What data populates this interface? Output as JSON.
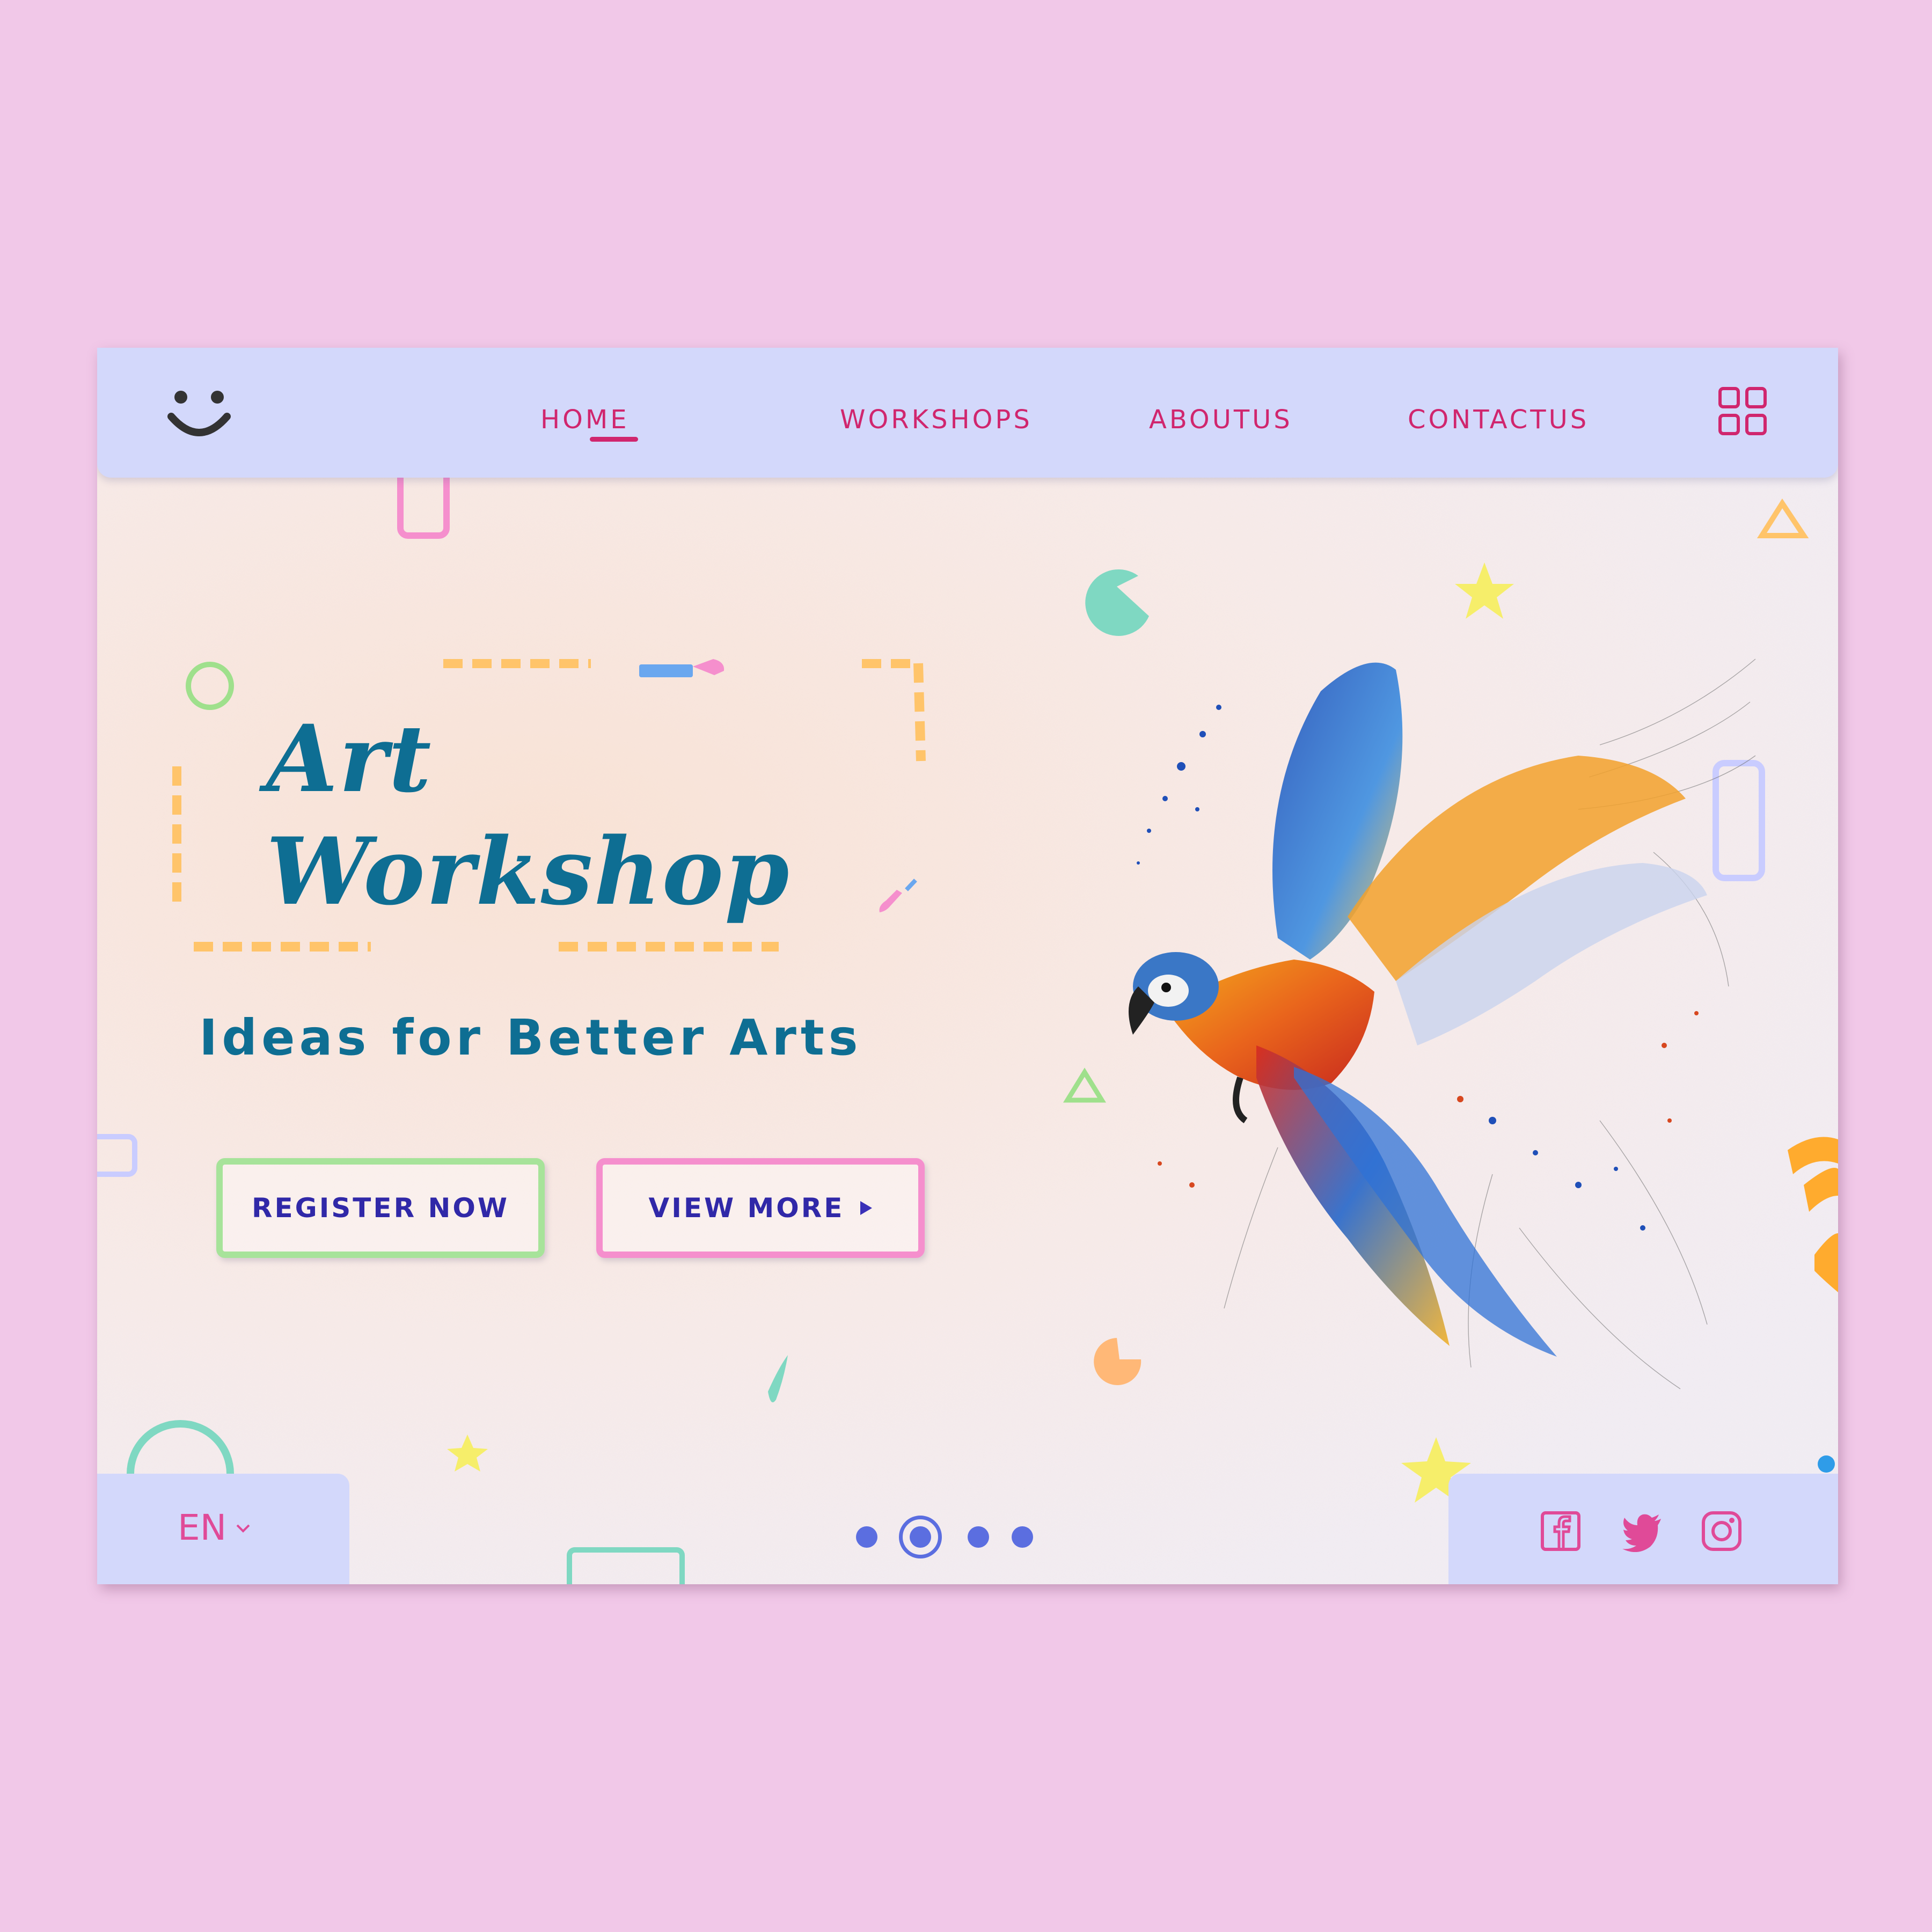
{
  "nav": {
    "items": [
      {
        "label": "HOME",
        "active": true
      },
      {
        "label": "WORKSHOPS",
        "active": false
      },
      {
        "label": "ABOUTUS",
        "active": false
      },
      {
        "label": "CONTACTUS",
        "active": false
      }
    ],
    "logo_icon": "smiley-face-icon",
    "menu_icon": "grid-menu-icon"
  },
  "hero": {
    "title_line1": "Art",
    "title_line2": "Workshop",
    "subtitle": "Ideas for Better Arts",
    "register_label": "REGISTER NOW",
    "view_more_label": "VIEW MORE"
  },
  "footer": {
    "language": "EN",
    "slider": {
      "count": 4,
      "active_index": 1
    },
    "social_icons": [
      "facebook-icon",
      "twitter-icon",
      "instagram-icon"
    ]
  },
  "colors": {
    "page_background": "#f1c8e8",
    "nav_background": "#d3d8fb",
    "nav_link": "#d0266e",
    "title": "#0e6e93",
    "button_text": "#3028a8",
    "register_border": "#a7e39a",
    "view_more_border": "#f58fcd",
    "slider_dot": "#5b6ee0",
    "social_icon": "#e04a98"
  }
}
